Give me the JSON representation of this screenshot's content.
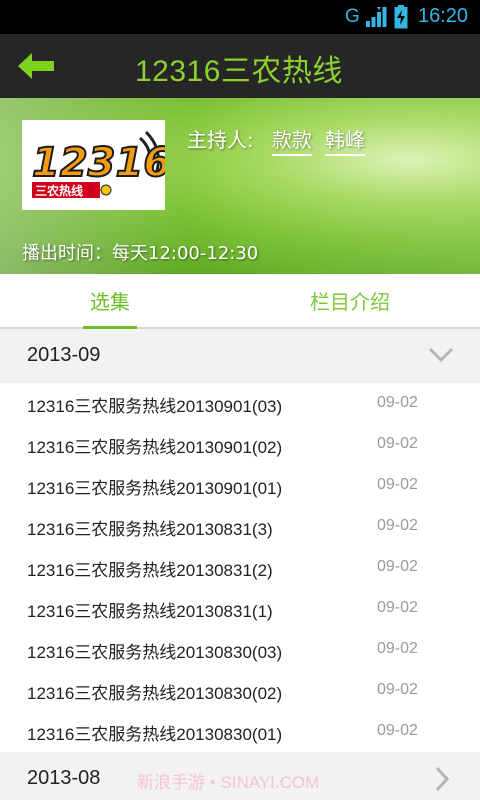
{
  "status_bar": {
    "network": "G",
    "time": "16:20",
    "icons": [
      "signal-icon",
      "battery-charging-icon"
    ]
  },
  "title_bar": {
    "back_icon": "arrow-left-icon",
    "title": "12316三农热线"
  },
  "program": {
    "logo": {
      "number": "12316",
      "subtitle": "三农热线"
    },
    "host_label": "主持人:",
    "hosts": [
      "款款",
      "韩峰"
    ],
    "air_time": "播出时间：每天12:00-12:30"
  },
  "tabs": [
    {
      "label": "选集",
      "active": true
    },
    {
      "label": "栏目介绍",
      "active": false
    }
  ],
  "months": [
    {
      "label": "2013-09",
      "expanded": true,
      "episodes": [
        {
          "name": "12316三农服务热线20130901(03)",
          "date": "09-02"
        },
        {
          "name": "12316三农服务热线20130901(02)",
          "date": "09-02"
        },
        {
          "name": "12316三农服务热线20130901(01)",
          "date": "09-02"
        },
        {
          "name": "12316三农服务热线20130831(3)",
          "date": "09-02"
        },
        {
          "name": "12316三农服务热线20130831(2)",
          "date": "09-02"
        },
        {
          "name": "12316三农服务热线20130831(1)",
          "date": "09-02"
        },
        {
          "name": "12316三农服务热线20130830(03)",
          "date": "09-02"
        },
        {
          "name": "12316三农服务热线20130830(02)",
          "date": "09-02"
        },
        {
          "name": "12316三农服务热线20130830(01)",
          "date": "09-02"
        }
      ]
    },
    {
      "label": "2013-08",
      "expanded": false,
      "episodes": []
    }
  ],
  "watermark": "新浪手游 • SINAYI.COM",
  "colors": {
    "accent": "#8cd12f",
    "tab_green": "#6cbf27",
    "status_blue": "#33b5e5",
    "title_bg": "#262626"
  }
}
